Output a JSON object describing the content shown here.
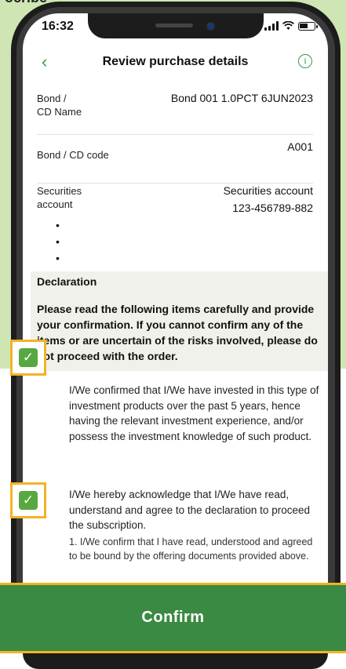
{
  "background": {
    "caption_fragment": "ocribe"
  },
  "status_bar": {
    "time": "16:32"
  },
  "nav": {
    "title": "Review purchase details",
    "back_glyph": "‹",
    "info_glyph": "i"
  },
  "details": [
    {
      "label": "Bond /\nCD Name",
      "value": "Bond 001 1.0PCT 6JUN2023"
    },
    {
      "label": "Bond / CD code",
      "value": "A001"
    },
    {
      "label": "Securities\naccount",
      "value": "Securities account\n123-456789-882"
    }
  ],
  "bullets": [
    "•",
    "•",
    "•"
  ],
  "declaration": {
    "title": "Declaration",
    "text": "Please read the following items carefully and provide your confirmation. If you cannot confirm any of the items or are uncertain of the risks involved, please do not proceed with the order."
  },
  "items": [
    {
      "checked": true,
      "text": "I/We confirmed that I/We have invested in this type of investment products over the past 5 years, hence having the relevant investment experience, and/or possess the investment knowledge of such product."
    },
    {
      "checked": true,
      "text": "I/We hereby acknowledge that I/We have read, understand and agree to the declaration to proceed the subscription.",
      "sub": "1. I/We confirm that I have read, understood and agreed to be bound by the offering documents provided above."
    }
  ],
  "confirm": {
    "label": "Confirm"
  },
  "colors": {
    "accent": "#2e9c4a",
    "button": "#3a8a43",
    "highlight": "#f4b324",
    "checkbox": "#57a83e"
  },
  "icons": {
    "check": "checkmark-icon",
    "back": "chevron-left-icon",
    "info": "info-icon"
  }
}
